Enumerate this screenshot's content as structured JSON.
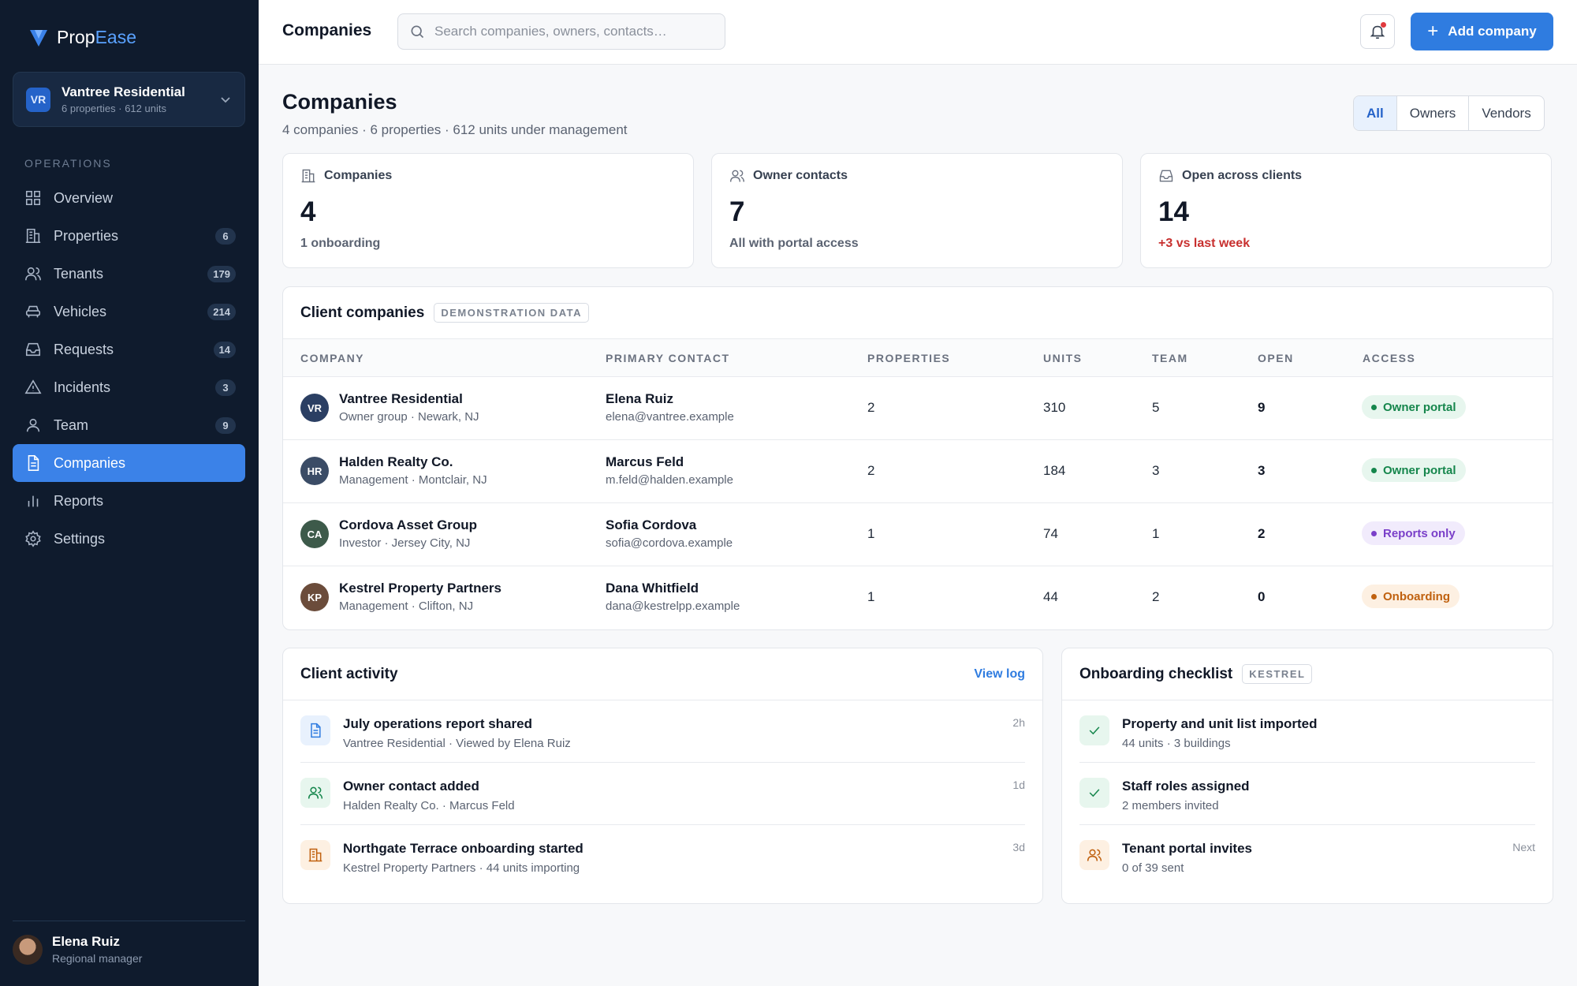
{
  "brand": {
    "part1": "Prop",
    "part2": "Ease"
  },
  "org": {
    "initials": "VR",
    "name": "Vantree Residential",
    "sub": "6 properties · 612 units"
  },
  "sidebar": {
    "section_label": "OPERATIONS",
    "items": [
      {
        "label": "Overview",
        "icon": "grid-icon"
      },
      {
        "label": "Properties",
        "icon": "building-icon",
        "badge": "6"
      },
      {
        "label": "Tenants",
        "icon": "users-icon",
        "badge": "179"
      },
      {
        "label": "Vehicles",
        "icon": "car-icon",
        "badge": "214"
      },
      {
        "label": "Requests",
        "icon": "inbox-icon",
        "badge": "14"
      },
      {
        "label": "Incidents",
        "icon": "alert-triangle-icon",
        "badge": "3"
      },
      {
        "label": "Team",
        "icon": "user-icon",
        "badge": "9"
      },
      {
        "label": "Companies",
        "icon": "document-icon",
        "active": true
      },
      {
        "label": "Reports",
        "icon": "bar-chart-icon"
      },
      {
        "label": "Settings",
        "icon": "gear-icon"
      }
    ]
  },
  "user": {
    "name": "Elena Ruiz",
    "role": "Regional manager"
  },
  "topbar": {
    "title": "Companies",
    "search_placeholder": "Search companies, owners, contacts…",
    "add_label": "Add company"
  },
  "page": {
    "title": "Companies",
    "subtitle": "4 companies · 6 properties · 612 units under management",
    "filters": [
      "All",
      "Owners",
      "Vendors"
    ],
    "active_filter": "All"
  },
  "stats": [
    {
      "label": "Companies",
      "value": "4",
      "note": "1 onboarding",
      "icon": "building-icon"
    },
    {
      "label": "Owner contacts",
      "value": "7",
      "note": "All with portal access",
      "icon": "users-icon"
    },
    {
      "label": "Open across clients",
      "value": "14",
      "note": "+3 vs last week",
      "icon": "inbox-icon",
      "alert": true
    }
  ],
  "table": {
    "title": "Client companies",
    "tag": "DEMONSTRATION DATA",
    "columns": [
      "COMPANY",
      "PRIMARY CONTACT",
      "PROPERTIES",
      "UNITS",
      "TEAM",
      "OPEN",
      "ACCESS"
    ],
    "rows": [
      {
        "initials": "VR",
        "avatar_color": "#2b3f63",
        "company": "Vantree Residential",
        "company_sub": "Owner group · Newark, NJ",
        "contact": "Elena Ruiz",
        "email": "elena@vantree.example",
        "properties": "2",
        "units": "310",
        "team": "5",
        "open": "9",
        "access": "Owner portal",
        "access_style": "green"
      },
      {
        "initials": "HR",
        "avatar_color": "#3b4c66",
        "company": "Halden Realty Co.",
        "company_sub": "Management · Montclair, NJ",
        "contact": "Marcus Feld",
        "email": "m.feld@halden.example",
        "properties": "2",
        "units": "184",
        "team": "3",
        "open": "3",
        "access": "Owner portal",
        "access_style": "green"
      },
      {
        "initials": "CA",
        "avatar_color": "#3d5a4a",
        "company": "Cordova Asset Group",
        "company_sub": "Investor · Jersey City, NJ",
        "contact": "Sofia Cordova",
        "email": "sofia@cordova.example",
        "properties": "1",
        "units": "74",
        "team": "1",
        "open": "2",
        "access": "Reports only",
        "access_style": "purple"
      },
      {
        "initials": "KP",
        "avatar_color": "#6b4c3b",
        "company": "Kestrel Property Partners",
        "company_sub": "Management · Clifton, NJ",
        "contact": "Dana Whitfield",
        "email": "dana@kestrelpp.example",
        "properties": "1",
        "units": "44",
        "team": "2",
        "open": "0",
        "access": "Onboarding",
        "access_style": "orange"
      }
    ]
  },
  "activity": {
    "title": "Client activity",
    "link": "View log",
    "items": [
      {
        "title": "July operations report shared",
        "sub": "Vantree Residential · Viewed by Elena Ruiz",
        "time": "2h",
        "icon": "document-icon",
        "tone": "blue"
      },
      {
        "title": "Owner contact added",
        "sub": "Halden Realty Co. · Marcus Feld",
        "time": "1d",
        "icon": "users-icon",
        "tone": "green"
      },
      {
        "title": "Northgate Terrace onboarding started",
        "sub": "Kestrel Property Partners · 44 units importing",
        "time": "3d",
        "icon": "building-icon",
        "tone": "orange"
      }
    ]
  },
  "checklist": {
    "title": "Onboarding checklist",
    "tag": "KESTREL",
    "items": [
      {
        "title": "Property and unit list imported",
        "sub": "44 units · 3 buildings",
        "status": "done",
        "icon": "check-icon"
      },
      {
        "title": "Staff roles assigned",
        "sub": "2 members invited",
        "status": "done",
        "icon": "check-icon"
      },
      {
        "title": "Tenant portal invites",
        "sub": "0 of 39 sent",
        "status": "Next",
        "icon": "users-icon"
      }
    ]
  },
  "colors": {
    "accent": "#2f7ce0",
    "sidebar_bg": "#0f1b2d",
    "alert": "#c8302f"
  }
}
